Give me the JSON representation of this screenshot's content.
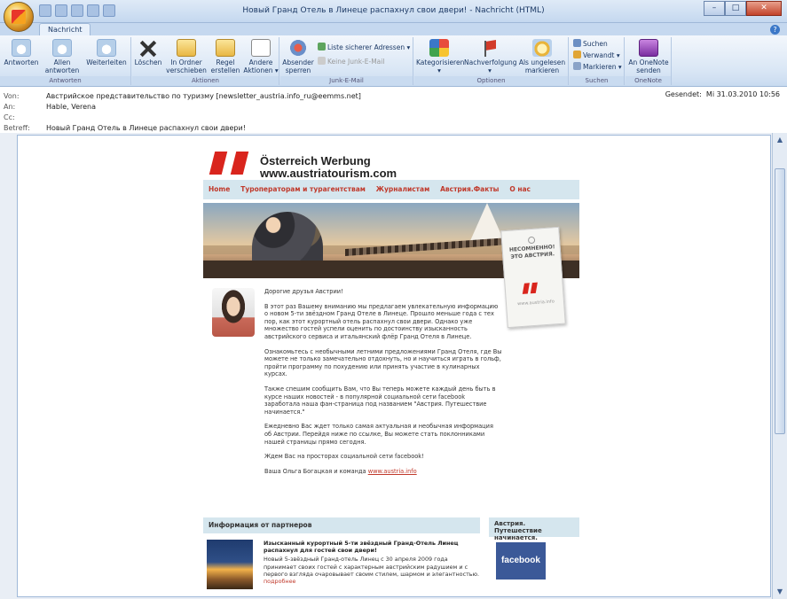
{
  "window": {
    "title": "Новый Гранд Отель в Линеце распахнул свои двери! - Nachricht (HTML)",
    "controls": {
      "minimize": "–",
      "maximize": "□",
      "close": "✕"
    }
  },
  "tabs": [
    {
      "label": "Nachricht"
    }
  ],
  "ribbon": {
    "groups": [
      {
        "label": "Antworten",
        "buttons": [
          {
            "label": "Antworten",
            "icon": "reply-icon"
          },
          {
            "label": "Allen antworten",
            "icon": "reply-all-icon"
          },
          {
            "label": "Weiterleiten",
            "icon": "forward-icon"
          }
        ]
      },
      {
        "label": "Aktionen",
        "buttons": [
          {
            "label": "Löschen",
            "icon": "delete-icon"
          },
          {
            "label": "In Ordner verschieben ▾",
            "icon": "move-folder-icon"
          },
          {
            "label": "Regel erstellen",
            "icon": "rule-icon"
          },
          {
            "label": "Andere Aktionen ▾",
            "icon": "other-actions-icon"
          }
        ]
      },
      {
        "label": "Junk-E-Mail",
        "buttons": [
          {
            "label": "Absender sperren",
            "icon": "block-sender-icon"
          }
        ],
        "small": [
          {
            "label": "Liste sicherer Adressen ▾",
            "icon": "safe-list-icon"
          },
          {
            "label": "Keine Junk-E-Mail",
            "icon": "not-junk-icon"
          }
        ]
      },
      {
        "label": "Optionen",
        "buttons": [
          {
            "label": "Kategorisieren ▾",
            "icon": "categorize-icon"
          },
          {
            "label": "Nachverfolgung ▾",
            "icon": "follow-up-icon"
          },
          {
            "label": "Als ungelesen markieren",
            "icon": "mark-unread-icon"
          }
        ]
      },
      {
        "label": "Suchen",
        "small": [
          {
            "label": "Suchen",
            "icon": "find-icon"
          },
          {
            "label": "Verwandt ▾",
            "icon": "related-icon"
          },
          {
            "label": "Markieren ▾",
            "icon": "select-icon"
          }
        ]
      },
      {
        "label": "OneNote",
        "buttons": [
          {
            "label": "An OneNote senden",
            "icon": "onenote-icon"
          }
        ]
      }
    ]
  },
  "headers": {
    "from_label": "Von:",
    "from": "Австрийское представительство по туризму [newsletter_austria.info_ru@eemms.net]",
    "to_label": "An:",
    "to": "Hable, Verena",
    "cc_label": "Cc:",
    "cc": "",
    "subject_label": "Betreff:",
    "subject": "Новый Гранд Отель в Линеце распахнул свои двери!",
    "sent_label": "Gesendet:",
    "sent": "Mi 31.03.2010 10:56"
  },
  "newsletter": {
    "brand_line1": "Österreich Werbung",
    "brand_line2": "www.austriatourism.com",
    "nav": [
      "Home",
      "Туроператорам и турагентствам",
      "Журналистам",
      "Австрия.Факты",
      "О нас"
    ],
    "tag_text": "НЕСОМНЕННО! ЭТО АВСТРИЯ.",
    "tag_url": "www.austria.info",
    "greeting": "Дорогие друзья Австрии!",
    "paragraphs": [
      "В этот раз Вашему вниманию мы предлагаем увлекательную информацию о новом 5-ти звёздном Гранд Отеле в Линеце. Прошло меньше года с тех пор, как этот курортный отель распахнул свои двери. Однако уже множество гостей успели оценить по достоинству изысканность австрийского сервиса и итальянский флёр Гранд Отеля в Линеце.",
      "Ознакомьтесь с необычными летними предложениями Гранд Отеля, где Вы можете не только замечательно отдохнуть, но и научиться играть в гольф, пройти программу по похудению или принять участие в кулинарных курсах.",
      "Также спешим сообщить Вам, что Вы теперь можете каждый день быть в курсе наших новостей - в популярной социальной сети facebook заработала наша фан-страница под названием \"Австрия. Путешествие начинается.\"",
      "Ежедневно Вас ждет только самая актуальная и необычная информация об Австрии. Перейдя ниже по ссылке, Вы можете стать поклонниками нашей страницы прямо сегодня.",
      "Ждем Вас на просторах социальной сети facebook!"
    ],
    "signature": "Ваша Ольга Богацкая и команда",
    "signature_link": "www.austria.info",
    "partners_header": "Информация от партнеров",
    "sidebox_header": "Австрия. Путешествие начинается.",
    "partner_title": "Изысканный курортный 5-ти звёздный Гранд-Отель Линец распахнул для гостей свои двери!",
    "partner_text": "Новый 5-звёздный Гранд-отель Линец с 30 апреля 2009 года принимает своих гостей с характерным австрийским радушием и с первого взгляда очаровывает своим стилем, шармом и элегантностью.",
    "partner_more": "подробнее",
    "facebook_label": "facebook"
  }
}
